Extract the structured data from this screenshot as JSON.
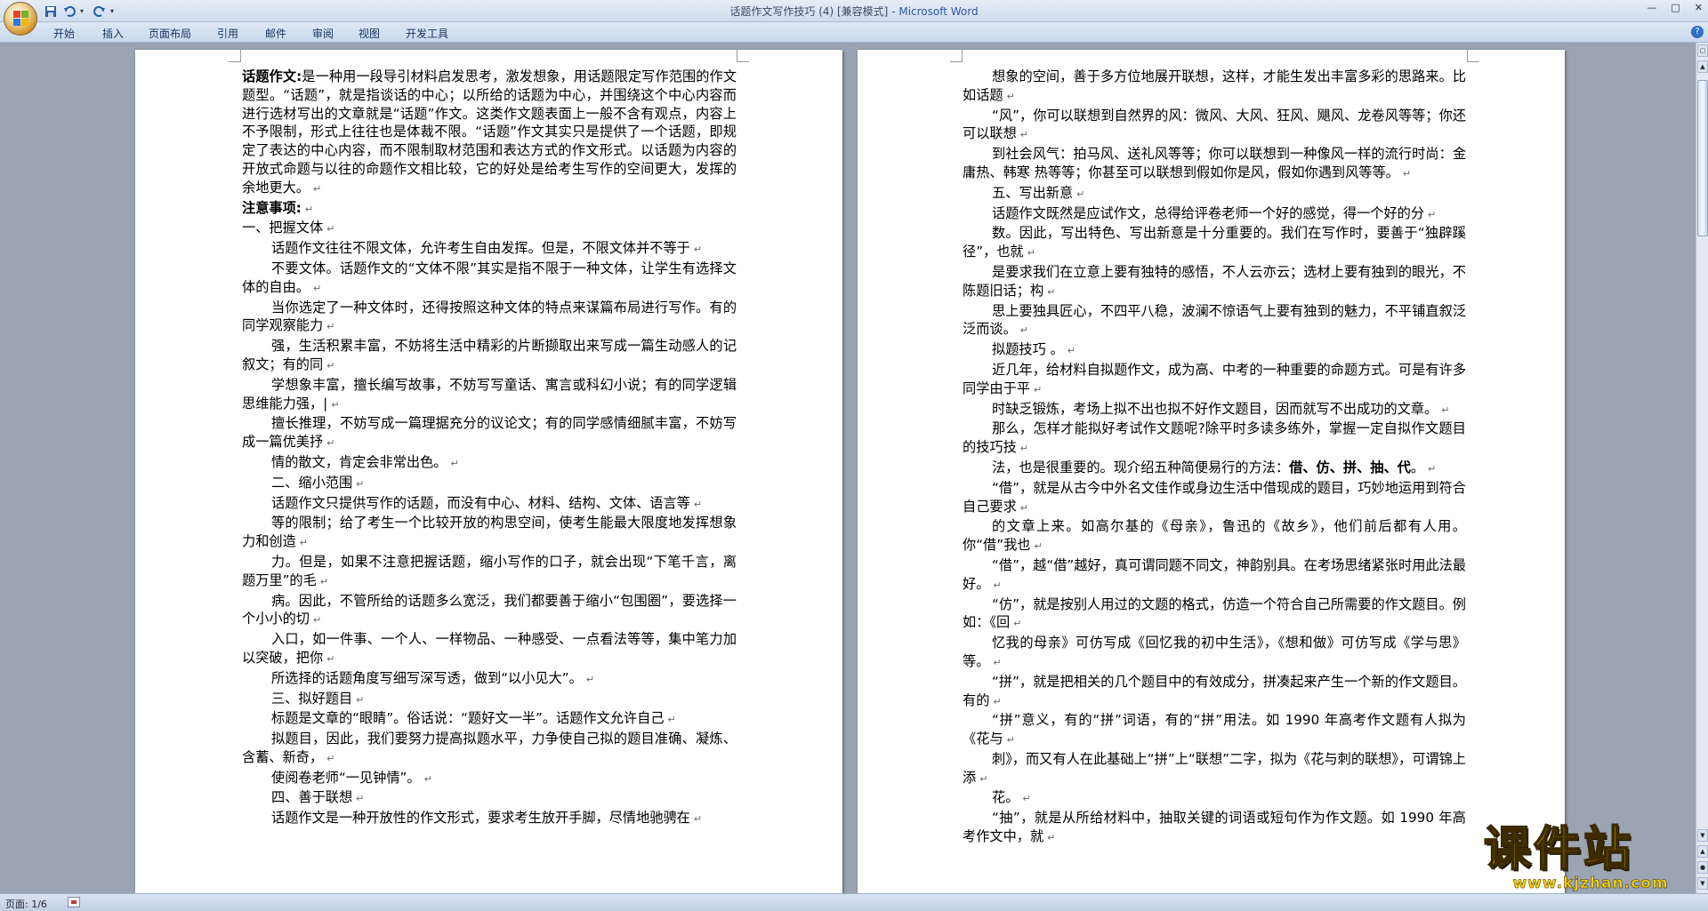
{
  "window": {
    "title": "话题作文写作技巧 (4) [兼容模式]",
    "title_separator": " - ",
    "app_name": "Microsoft Word"
  },
  "quick_access": {
    "save_icon": "save-icon",
    "undo_icon": "undo-icon",
    "redo_icon": "redo-icon",
    "customize_icon": "customize-qat-icon"
  },
  "ribbon": {
    "tabs": [
      {
        "label": "开始"
      },
      {
        "label": "插入"
      },
      {
        "label": "页面布局"
      },
      {
        "label": "引用"
      },
      {
        "label": "邮件"
      },
      {
        "label": "审阅"
      },
      {
        "label": "视图"
      },
      {
        "label": "开发工具"
      }
    ],
    "help_label": "?"
  },
  "document": {
    "page1": [
      {
        "bold_lead": "话题作文:",
        "text": "是一种用一段导引材料启发思考，激发想象，用话题限定写作范围的作文题型。“话题”，就是指谈话的中心；以所给的话题为中心，并围绕这个中心内容而进行选材写出的文章就是“话题”作文。这类作文题表面上一般不含有观点，内容上不予限制，形式上往往也是体裁不限。“话题”作文其实只是提供了一个话题，即规定了表达的中心内容，而不限制取材范围和表达方式的作文形式。以话题为内容的开放式命题与以往的命题作文相比较，它的好处是给考生写作的空间更大，发挥的余地更大。"
      },
      {
        "bold_lead": "注意事项:",
        "text": ""
      },
      {
        "text": "一、把握文体"
      },
      {
        "text": "话题作文往往不限文体，允许考生自由发挥。但是，不限文体并不等于",
        "indent": true
      },
      {
        "text": "不要文体。话题作文的“文体不限”其实是指不限于一种文体，让学生有选择文体的自由。",
        "indent": true
      },
      {
        "text": "当你选定了一种文体时，还得按照这种文体的特点来谋篇布局进行写作。有的同学观察能力",
        "indent": true
      },
      {
        "text": "强，生活积累丰富，不妨将生活中精彩的片断撷取出来写成一篇生动感人的记叙文；有的同",
        "indent": true
      },
      {
        "text": "学想象丰富，擅长编写故事，不妨写写童话、寓言或科幻小说；有的同学逻辑思维能力强，|",
        "indent": true
      },
      {
        "text": "擅长推理，不妨写成一篇理据充分的议论文；有的同学感情细腻丰富，不妨写成一篇优美抒",
        "indent": true
      },
      {
        "text": "情的散文，肯定会非常出色。",
        "indent": true
      },
      {
        "text": "二、缩小范围",
        "indent": true
      },
      {
        "text": "话题作文只提供写作的话题，而没有中心、材料、结构、文体、语言等",
        "indent": true
      },
      {
        "text": "等的限制；给了考生一个比较开放的构思空间，使考生能最大限度地发挥想象力和创造",
        "indent": true
      },
      {
        "text": "力。但是，如果不注意把握话题，缩小写作的口子，就会出现“下笔千言，离题万里”的毛",
        "indent": true
      },
      {
        "text": "病。因此，不管所给的话题多么宽泛，我们都要善于缩小“包围圈”，要选择一个小小的切",
        "indent": true
      },
      {
        "text": "入口，如一件事、一个人、一样物品、一种感受、一点看法等等，集中笔力加以突破，把你",
        "indent": true
      },
      {
        "text": "所选择的话题角度写细写深写透，做到“以小见大”。",
        "indent": true
      },
      {
        "text": "三、拟好题目",
        "indent": true
      },
      {
        "text": "标题是文章的“眼睛”。俗话说：“题好文一半”。话题作文允许自己",
        "indent": true
      },
      {
        "text": "拟题目，因此，我们要努力提高拟题水平，力争使自己拟的题目准确、凝炼、含蓄、新奇，",
        "indent": true
      },
      {
        "text": "使阅卷老师“一见钟情”。",
        "indent": true
      },
      {
        "text": "四、善于联想",
        "indent": true
      },
      {
        "text": "话题作文是一种开放性的作文形式，要求考生放开手脚，尽情地驰骋在",
        "indent": true
      }
    ],
    "page2": [
      {
        "text": "想象的空间，善于多方位地展开联想，这样，才能生发出丰富多彩的思路来。比如话题",
        "indent": true
      },
      {
        "text": "“风”，你可以联想到自然界的风：微风、大风、狂风、飓风、龙卷风等等；你还可以联想",
        "indent": true
      },
      {
        "text": "到社会风气：拍马风、送礼风等等；你可以联想到一种像风一样的流行时尚：金庸热、韩寒 热等等；你甚至可以联想到假如你是风，假如你遇到风等等。",
        "indent": true
      },
      {
        "text": "五、写出新意",
        "indent": true
      },
      {
        "text": "话题作文既然是应试作文，总得给评卷老师一个好的感觉，得一个好的分",
        "indent": true
      },
      {
        "text": "数。因此，写出特色、写出新意是十分重要的。我们在写作时，要善于“独辟蹊径”，也就",
        "indent": true
      },
      {
        "text": "是要求我们在立意上要有独特的感悟，不人云亦云；选材上要有独到的眼光，不陈题旧话；构",
        "indent": true
      },
      {
        "text": "思上要独具匠心，不四平八稳，波澜不惊语气上要有独到的魅力，不平铺直叙泛泛而谈。",
        "indent": true
      },
      {
        "text": "拟题技巧 。",
        "indent": true
      },
      {
        "text": "近几年，给材料自拟题作文，成为高、中考的一种重要的命题方式。可是有许多同学由于平",
        "indent": true
      },
      {
        "text": "时缺乏锻炼，考场上拟不出也拟不好作文题目，因而就写不出成功的文章。",
        "indent": true
      },
      {
        "text": "那么，怎样才能拟好考试作文题呢?除平时多读多练外，掌握一定自拟作文题目的技巧技",
        "indent": true
      },
      {
        "text": "法，也是很重要的。现介绍五种简便易行的方法：",
        "bold_tail": "借、仿、拼、抽、代",
        "tail": "。",
        "indent": true
      },
      {
        "text": "“借”，就是从古今中外名文佳作或身边生活中借现成的题目，巧妙地运用到符合自己要求",
        "indent": true
      },
      {
        "text": "的文章上来。如高尔基的《母亲》，鲁迅的《故乡》，他们前后都有人用。你“借”我也",
        "indent": true
      },
      {
        "text": "“借”，越“借”越好，真可谓同题不同文，神韵别具。在考场思绪紧张时用此法最好。",
        "indent": true
      },
      {
        "text": "“仿”，就是按别人用过的文题的格式，仿造一个符合自己所需要的作文题目。例如：《回",
        "indent": true
      },
      {
        "text": "忆我的母亲》可仿写成《回忆我的初中生活》，《想和做》可仿写成《学与思》等。",
        "indent": true
      },
      {
        "text": "“拼”，就是把相关的几个题目中的有效成分，拼凑起来产生一个新的作文题目。有的",
        "indent": true
      },
      {
        "text": "“拼”意义，有的“拼”词语，有的“拼”用法。如 1990 年高考作文题有人拟为《花与",
        "indent": true
      },
      {
        "text": "刺》，而又有人在此基础上“拼”上“联想”二字，拟为《花与刺的联想》，可谓锦上添",
        "indent": true
      },
      {
        "text": "花。",
        "indent": true
      },
      {
        "text": "“抽”，就是从所给材料中，抽取关键的词语或短句作为作文题。如 1990 年高考作文中，就",
        "indent": true
      }
    ]
  },
  "statusbar": {
    "page_info": "页面: 1/6"
  },
  "watermark": {
    "title": "课件站",
    "url": "www.kjzhan.com"
  }
}
